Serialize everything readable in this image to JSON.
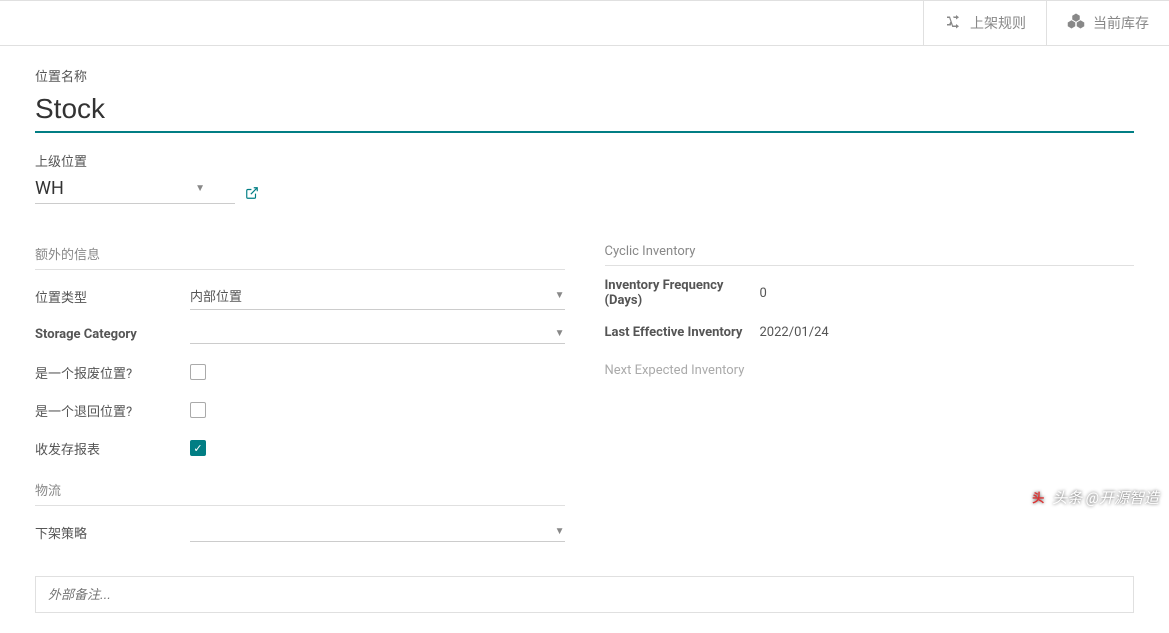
{
  "toolbar": {
    "putaway_rules_label": "上架规则",
    "current_stock_label": "当前库存"
  },
  "title": {
    "label": "位置名称",
    "value": "Stock"
  },
  "parent": {
    "label": "上级位置",
    "value": "WH"
  },
  "left": {
    "section_title": "额外的信息",
    "location_type_label": "位置类型",
    "location_type_value": "内部位置",
    "storage_category_label": "Storage Category",
    "storage_category_value": "",
    "is_scrap_label": "是一个报废位置?",
    "is_return_label": "是一个退回位置?",
    "stock_report_label": "收发存报表",
    "logistics_title": "物流",
    "removal_strategy_label": "下架策略",
    "removal_strategy_value": ""
  },
  "right": {
    "section_title": "Cyclic Inventory",
    "inventory_frequency_label": "Inventory Frequency (Days)",
    "inventory_frequency_value": "0",
    "last_effective_label": "Last Effective Inventory",
    "last_effective_value": "2022/01/24",
    "next_expected_label": "Next Expected Inventory",
    "next_expected_value": ""
  },
  "notes_placeholder": "外部备注...",
  "watermark": "头条 @开源智造"
}
